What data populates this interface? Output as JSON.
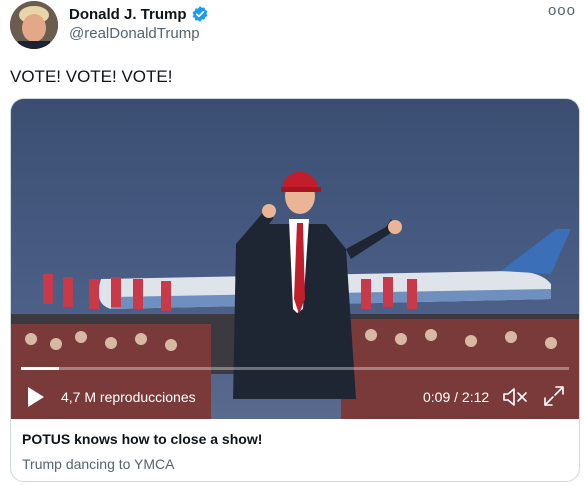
{
  "user": {
    "name": "Donald J. Trump",
    "handle": "@realDonaldTrump",
    "verified_color": "#1d9bf0"
  },
  "more_label": "ooo",
  "tweet": {
    "text": "VOTE! VOTE! VOTE!"
  },
  "video": {
    "views": "4,7 M reproducciones",
    "time": "0:09 / 2:12",
    "progress_fraction": 0.069
  },
  "card": {
    "title": "POTUS knows how to close a show!",
    "description": "Trump dancing to YMCA"
  }
}
